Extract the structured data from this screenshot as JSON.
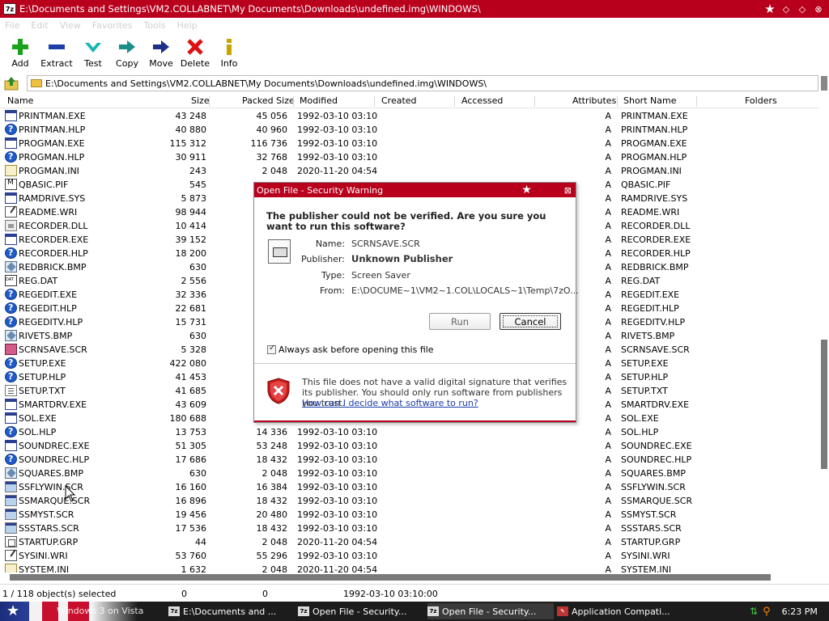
{
  "window": {
    "app_icon": "7z",
    "title": "E:\\Documents and Settings\\VM2.COLLABNET\\My Documents\\Downloads\\undefined.img\\WINDOWS\\",
    "buttons": [
      "star-icon",
      "minimize-icon",
      "restore-icon",
      "close-icon"
    ]
  },
  "menu": [
    "File",
    "Edit",
    "View",
    "Favorites",
    "Tools",
    "Help"
  ],
  "toolbar": {
    "add": "Add",
    "extract": "Extract",
    "test": "Test",
    "copy": "Copy",
    "move": "Move",
    "delete": "Delete",
    "info": "Info"
  },
  "address": "E:\\Documents and Settings\\VM2.COLLABNET\\My Documents\\Downloads\\undefined.img\\WINDOWS\\",
  "columns": {
    "name": "Name",
    "size": "Size",
    "packed": "Packed Size",
    "modified": "Modified",
    "created": "Created",
    "accessed": "Accessed",
    "attributes": "Attributes",
    "short": "Short Name",
    "folders": "Folders"
  },
  "files": [
    {
      "name": "PRINTMAN.EXE",
      "size": "43 248",
      "packed": "45 056",
      "modified": "1992-03-10 03:10",
      "attr": "A",
      "short": "PRINTMAN.EXE",
      "icon": "exe"
    },
    {
      "name": "PRINTMAN.HLP",
      "size": "40 880",
      "packed": "40 960",
      "modified": "1992-03-10 03:10",
      "attr": "A",
      "short": "PRINTMAN.HLP",
      "icon": "help"
    },
    {
      "name": "PROGMAN.EXE",
      "size": "115 312",
      "packed": "116 736",
      "modified": "1992-03-10 03:10",
      "attr": "A",
      "short": "PROGMAN.EXE",
      "icon": "exe"
    },
    {
      "name": "PROGMAN.HLP",
      "size": "30 911",
      "packed": "32 768",
      "modified": "1992-03-10 03:10",
      "attr": "A",
      "short": "PROGMAN.HLP",
      "icon": "help"
    },
    {
      "name": "PROGMAN.INI",
      "size": "243",
      "packed": "2 048",
      "modified": "2020-11-20 04:54",
      "attr": "A",
      "short": "PROGMAN.INI",
      "icon": "ini"
    },
    {
      "name": "QBASIC.PIF",
      "size": "545",
      "packed": "",
      "modified": "",
      "attr": "A",
      "short": "QBASIC.PIF",
      "icon": "pif"
    },
    {
      "name": "RAMDRIVE.SYS",
      "size": "5 873",
      "packed": "",
      "modified": "",
      "attr": "A",
      "short": "RAMDRIVE.SYS",
      "icon": "exe"
    },
    {
      "name": "README.WRI",
      "size": "98 944",
      "packed": "",
      "modified": "",
      "attr": "A",
      "short": "README.WRI",
      "icon": "wri"
    },
    {
      "name": "RECORDER.DLL",
      "size": "10 414",
      "packed": "",
      "modified": "",
      "attr": "A",
      "short": "RECORDER.DLL",
      "icon": "dll"
    },
    {
      "name": "RECORDER.EXE",
      "size": "39 152",
      "packed": "",
      "modified": "",
      "attr": "A",
      "short": "RECORDER.EXE",
      "icon": "exe"
    },
    {
      "name": "RECORDER.HLP",
      "size": "18 200",
      "packed": "",
      "modified": "",
      "attr": "A",
      "short": "RECORDER.HLP",
      "icon": "help"
    },
    {
      "name": "REDBRICK.BMP",
      "size": "630",
      "packed": "",
      "modified": "",
      "attr": "A",
      "short": "REDBRICK.BMP",
      "icon": "bmp"
    },
    {
      "name": "REG.DAT",
      "size": "2 556",
      "packed": "",
      "modified": "",
      "attr": "A",
      "short": "REG.DAT",
      "icon": "dat"
    },
    {
      "name": "REGEDIT.EXE",
      "size": "32 336",
      "packed": "",
      "modified": "",
      "attr": "A",
      "short": "REGEDIT.EXE",
      "icon": "help"
    },
    {
      "name": "REGEDIT.HLP",
      "size": "22 681",
      "packed": "",
      "modified": "",
      "attr": "A",
      "short": "REGEDIT.HLP",
      "icon": "help"
    },
    {
      "name": "REGEDITV.HLP",
      "size": "15 731",
      "packed": "",
      "modified": "",
      "attr": "A",
      "short": "REGEDITV.HLP",
      "icon": "help"
    },
    {
      "name": "RIVETS.BMP",
      "size": "630",
      "packed": "",
      "modified": "",
      "attr": "A",
      "short": "RIVETS.BMP",
      "icon": "bmp"
    },
    {
      "name": "SCRNSAVE.SCR",
      "size": "5 328",
      "packed": "",
      "modified": "",
      "attr": "A",
      "short": "SCRNSAVE.SCR",
      "icon": "scrsel"
    },
    {
      "name": "SETUP.EXE",
      "size": "422 080",
      "packed": "",
      "modified": "",
      "attr": "A",
      "short": "SETUP.EXE",
      "icon": "help"
    },
    {
      "name": "SETUP.HLP",
      "size": "41 453",
      "packed": "",
      "modified": "",
      "attr": "A",
      "short": "SETUP.HLP",
      "icon": "help"
    },
    {
      "name": "SETUP.TXT",
      "size": "41 685",
      "packed": "",
      "modified": "",
      "attr": "A",
      "short": "SETUP.TXT",
      "icon": "doc"
    },
    {
      "name": "SMARTDRV.EXE",
      "size": "43 609",
      "packed": "",
      "modified": "",
      "attr": "A",
      "short": "SMARTDRV.EXE",
      "icon": "exe"
    },
    {
      "name": "SOL.EXE",
      "size": "180 688",
      "packed": "",
      "modified": "",
      "attr": "A",
      "short": "SOL.EXE",
      "icon": "exe"
    },
    {
      "name": "SOL.HLP",
      "size": "13 753",
      "packed": "14 336",
      "modified": "1992-03-10 03:10",
      "attr": "A",
      "short": "SOL.HLP",
      "icon": "help"
    },
    {
      "name": "SOUNDREC.EXE",
      "size": "51 305",
      "packed": "53 248",
      "modified": "1992-03-10 03:10",
      "attr": "A",
      "short": "SOUNDREC.EXE",
      "icon": "exe"
    },
    {
      "name": "SOUNDREC.HLP",
      "size": "17 686",
      "packed": "18 432",
      "modified": "1992-03-10 03:10",
      "attr": "A",
      "short": "SOUNDREC.HLP",
      "icon": "help"
    },
    {
      "name": "SQUARES.BMP",
      "size": "630",
      "packed": "2 048",
      "modified": "1992-03-10 03:10",
      "attr": "A",
      "short": "SQUARES.BMP",
      "icon": "bmp"
    },
    {
      "name": "SSFLYWIN.SCR",
      "size": "16 160",
      "packed": "16 384",
      "modified": "1992-03-10 03:10",
      "attr": "A",
      "short": "SSFLYWIN.SCR",
      "icon": "scr"
    },
    {
      "name": "SSMARQUE.SCR",
      "size": "16 896",
      "packed": "18 432",
      "modified": "1992-03-10 03:10",
      "attr": "A",
      "short": "SSMARQUE.SCR",
      "icon": "scr"
    },
    {
      "name": "SSMYST.SCR",
      "size": "19 456",
      "packed": "20 480",
      "modified": "1992-03-10 03:10",
      "attr": "A",
      "short": "SSMYST.SCR",
      "icon": "scr"
    },
    {
      "name": "SSSTARS.SCR",
      "size": "17 536",
      "packed": "18 432",
      "modified": "1992-03-10 03:10",
      "attr": "A",
      "short": "SSSTARS.SCR",
      "icon": "scr"
    },
    {
      "name": "STARTUP.GRP",
      "size": "44",
      "packed": "2 048",
      "modified": "2020-11-20 04:54",
      "attr": "A",
      "short": "STARTUP.GRP",
      "icon": "grp"
    },
    {
      "name": "SYSINI.WRI",
      "size": "53 760",
      "packed": "55 296",
      "modified": "1992-03-10 03:10",
      "attr": "A",
      "short": "SYSINI.WRI",
      "icon": "wri"
    },
    {
      "name": "SYSTEM.INI",
      "size": "1 632",
      "packed": "2 048",
      "modified": "2020-11-20 04:54",
      "attr": "A",
      "short": "SYSTEM.INI",
      "icon": "ini"
    }
  ],
  "status": {
    "selection": "1 / 118 object(s) selected",
    "size": "0",
    "packed": "0",
    "modified": "1992-03-10 03:10:00"
  },
  "dialog": {
    "title": "Open File - Security Warning",
    "question": "The publisher could not be verified.  Are you sure you want to run this software?",
    "name_label": "Name:",
    "name_value": "SCRNSAVE.SCR",
    "publisher_label": "Publisher:",
    "publisher_value": "Unknown Publisher",
    "type_label": "Type:",
    "type_value": "Screen Saver",
    "from_label": "From:",
    "from_value": "E:\\DOCUME~1\\VM2~1.COL\\LOCALS~1\\Temp\\7zO...",
    "run_button": "Run",
    "cancel_button": "Cancel",
    "checkbox_label": "Always ask before opening this file",
    "checkbox_checked": true,
    "warning_text": "This file does not have a valid digital signature that verifies its publisher.  You should only run software from publishers you trust.",
    "warning_link": "How can I decide what software to run?"
  },
  "taskbar": {
    "start_text": "Windows 3 on Vista",
    "tasks": [
      {
        "label": "E:\\Documents and ...",
        "icon": "7z",
        "active": false
      },
      {
        "label": "Open File - Security...",
        "icon": "7z",
        "active": false
      },
      {
        "label": "Open File - Security...",
        "icon": "7z",
        "active": true
      },
      {
        "label": "Application Compati...",
        "icon": "app",
        "active": false
      }
    ],
    "time": "6:23 PM"
  }
}
